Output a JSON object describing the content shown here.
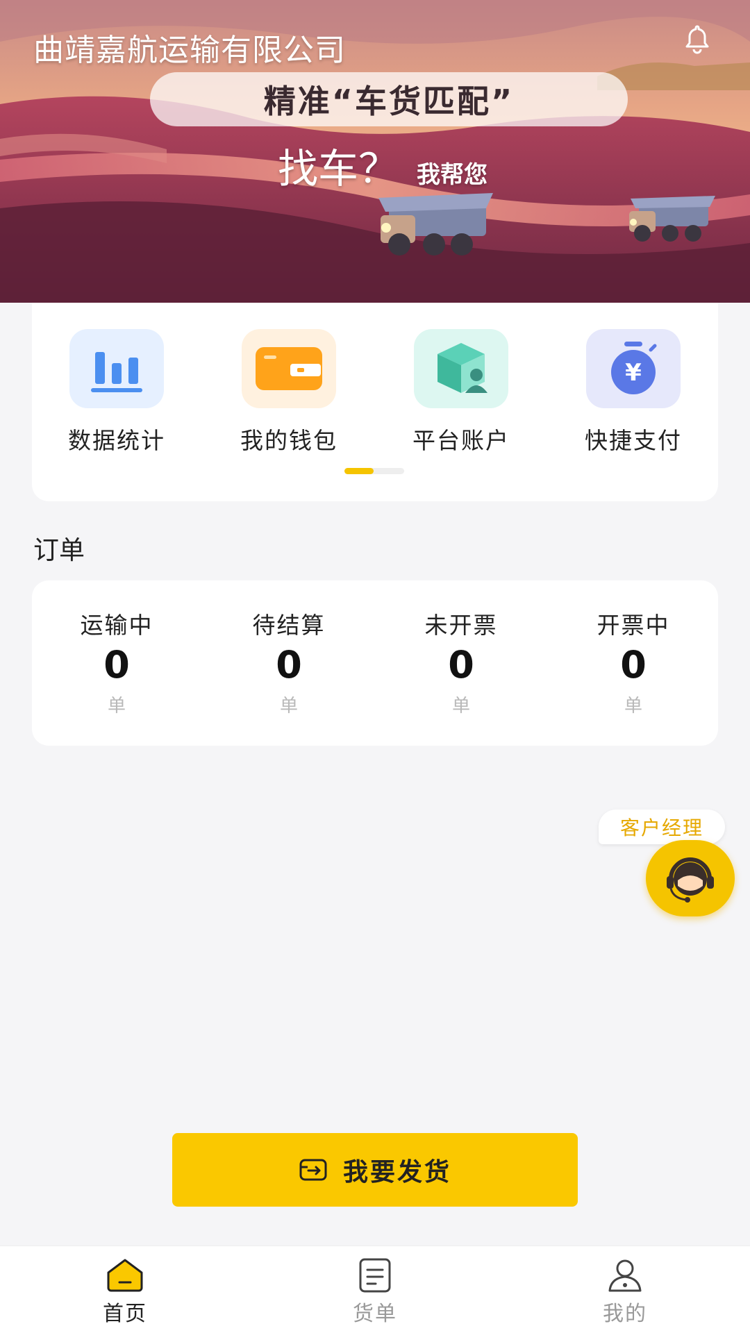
{
  "header": {
    "company_name": "曲靖嘉航运输有限公司",
    "slogan": "精准“车货匹配”",
    "sub_slogan_main": "找车？",
    "sub_slogan_small": "我帮您"
  },
  "quick_menu": {
    "items": [
      {
        "label": "数据统计",
        "icon": "bar-chart-icon"
      },
      {
        "label": "我的钱包",
        "icon": "wallet-icon"
      },
      {
        "label": "平台账户",
        "icon": "platform-account-icon"
      },
      {
        "label": "快捷支付",
        "icon": "quick-pay-icon"
      }
    ],
    "pager_total": 2,
    "pager_active": 1
  },
  "orders": {
    "title": "订单",
    "items": [
      {
        "label": "运输中",
        "count": "0",
        "unit": "单"
      },
      {
        "label": "待结算",
        "count": "0",
        "unit": "单"
      },
      {
        "label": "未开票",
        "count": "0",
        "unit": "单"
      },
      {
        "label": "开票中",
        "count": "0",
        "unit": "单"
      }
    ]
  },
  "customer_manager": {
    "label": "客户经理",
    "icon": "headset-agent-icon"
  },
  "ship_button": {
    "label": "我要发货",
    "icon": "ship-box-icon"
  },
  "tabbar": {
    "items": [
      {
        "label": "首页",
        "icon": "home-icon",
        "active": true
      },
      {
        "label": "货单",
        "icon": "waybill-icon",
        "active": false
      },
      {
        "label": "我的",
        "icon": "profile-icon",
        "active": false
      }
    ]
  },
  "colors": {
    "accent": "#fac800",
    "background": "#f5f5f7",
    "manager_text": "#e6a800"
  }
}
